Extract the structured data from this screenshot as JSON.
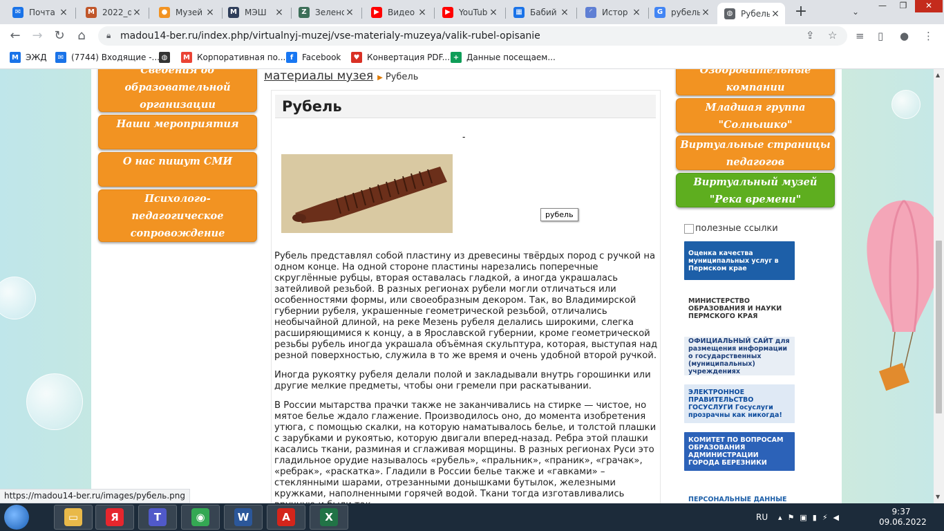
{
  "browser": {
    "tabs": [
      {
        "label": "Почта",
        "icon": "mail-icon",
        "color": "#1a73e8",
        "glyph": "✉"
      },
      {
        "label": "2022_q",
        "icon": "m-logo-icon",
        "color": "#c0562a",
        "glyph": "M"
      },
      {
        "label": "Музей",
        "icon": "site-icon",
        "color": "#f29322",
        "glyph": "●"
      },
      {
        "label": "МЭШ",
        "icon": "mesh-icon",
        "color": "#2f3e5a",
        "glyph": "M"
      },
      {
        "label": "Зелено",
        "icon": "spreadsheet-icon",
        "color": "#3c6e58",
        "glyph": "Z"
      },
      {
        "label": "Видео",
        "icon": "youtube-icon",
        "color": "#ff0000",
        "glyph": "▶"
      },
      {
        "label": "YouTub",
        "icon": "youtube-icon",
        "color": "#ff0000",
        "glyph": "▶"
      },
      {
        "label": "Бабий",
        "icon": "table-icon",
        "color": "#1a73e8",
        "glyph": "▦"
      },
      {
        "label": "Истор",
        "icon": "loading-icon",
        "color": "#5f7fd4",
        "glyph": "◜"
      },
      {
        "label": "рубель",
        "icon": "google-icon",
        "color": "#4285f4",
        "glyph": "G"
      },
      {
        "label": "Рубель",
        "icon": "globe-icon",
        "color": "#5f6368",
        "glyph": "◍",
        "active": true
      }
    ],
    "url": "madou14-ber.ru/index.php/virtualnyj-muzej/vse-materialy-muzeya/valik-rubel-opisanie",
    "bookmarks": [
      {
        "label": "ЭЖД",
        "icon": "m-icon",
        "color": "#1a73e8",
        "glyph": "M"
      },
      {
        "label": "(7744) Входящие -...",
        "icon": "mail-icon",
        "color": "#1a73e8",
        "glyph": "✉"
      },
      {
        "label": "",
        "icon": "globe-icon",
        "color": "#333333",
        "glyph": "◍"
      },
      {
        "label": "Корпоративная по...",
        "icon": "gmail-icon",
        "color": "#ea4335",
        "glyph": "M"
      },
      {
        "label": "Facebook",
        "icon": "facebook-icon",
        "color": "#1877f2",
        "glyph": "f"
      },
      {
        "label": "Конвертация PDF...",
        "icon": "heart-icon",
        "color": "#d93025",
        "glyph": "♥"
      },
      {
        "label": "Данные посещаем...",
        "icon": "sheet-icon",
        "color": "#0f9d58",
        "glyph": "+"
      }
    ],
    "status_url": "https://madou14-ber.ru/images/рубель.png"
  },
  "page": {
    "left_menu": [
      "Сведения об образовательной организации",
      "Наши мероприятия",
      "О нас пишут СМИ",
      "Психолого-педагогическое сопровождение"
    ],
    "right_menu": [
      "Оздоровительные компании",
      "Младшая группа \"Солнышко\"",
      "Виртуальные страницы педагогов",
      "Виртуальный музей \"Река времени\""
    ],
    "breadcrumb": {
      "parent": "материалы музея",
      "current": "Рубель"
    },
    "article": {
      "title": "Рубель",
      "dash": "-",
      "image_caption": "рубель",
      "paragraphs": [
        "Рубель представлял собой пластину из древесины твёрдых пород с ручкой на одном конце. На одной стороне пластины нарезались поперечные скруглённые рубцы, вторая оставалась гладкой, а иногда украшалась затейливой резьбой. В разных регионах рубели могли отличаться или особенностями формы, или своеобразным декором. Так, во Владимирской губернии рубеля, украшенные геометрической резьбой, отличались необычайной длиной, на реке Мезень рубеля делались широкими, слегка расширяющимися к концу, а в Ярославской губернии, кроме геометрической резьбы рубель иногда украшала объёмная скульптура, которая, выступая над резной поверхностью, служила в то же время и очень удобной второй ручкой.",
        "Иногда рукоятку рубеля делали полой и закладывали внутрь горошинки или другие мелкие предметы, чтобы они гремели при раскатывании.",
        "В России мытарства прачки также не заканчивались на стирке — чистое, но мятое белье ждало глажение. Производилось оно, до момента изобретения утюга, с помощью скалки, на которую наматывалось белье, и толстой плашки с зарубками и рукоятью, которую двигали вперед-назад. Ребра этой плашки касались ткани, разминая и сглаживая морщины. В разных регионах Руси это гладильное орудие называлось «рубель», «пральник», «праник», «грачак», «ребрак», «раскатка». Гладили в России белье также и «гавками» – стеклянными шарами, отрезанными донышками бутылок, железными кружками, наполненными горячей водой. Ткани тогда изготавливались вручную и были так"
      ]
    },
    "useful_links_alt": "полезные ссылки",
    "banners": [
      {
        "text": "Оценка качества муниципальных услуг в Пермском крае",
        "bg": "#1d5fa8",
        "fg": "#ffffff"
      },
      {
        "text": "МИНИСТЕРСТВО ОБРАЗОВАНИЯ И НАУКИ ПЕРМСКОГО КРАЯ",
        "bg": "#ffffff",
        "fg": "#333333"
      },
      {
        "text": "ОФИЦИАЛЬНЫЙ САЙТ для размещения информации о государственных (муниципальных) учреждениях",
        "bg": "#e8eef5",
        "fg": "#1d3f7a"
      },
      {
        "text": "ЭЛЕКТРОННОЕ ПРАВИТЕЛЬСТВО ГОСУСЛУГИ Госуслуги прозрачны как никогда!",
        "bg": "#dfe9f5",
        "fg": "#0b4a9c"
      },
      {
        "text": "КОМИТЕТ ПО ВОПРОСАМ ОБРАЗОВАНИЯ АДМИНИСТРАЦИИ ГОРОДА БЕРЕЗНИКИ",
        "bg": "#2c62b8",
        "fg": "#ffffff"
      },
      {
        "text": "ПЕРСОНАЛЬНЫЕ ДАННЫЕ",
        "bg": "#ffffff",
        "fg": "#1d5fa8"
      }
    ]
  },
  "taskbar": {
    "apps": [
      {
        "name": "file-explorer-icon",
        "glyph": "▭",
        "color": "#e9b949"
      },
      {
        "name": "yandex-icon",
        "glyph": "Я",
        "color": "#e6262d"
      },
      {
        "name": "teams-icon",
        "glyph": "T",
        "color": "#5059c9"
      },
      {
        "name": "chrome-icon",
        "glyph": "◉",
        "color": "#34a853"
      },
      {
        "name": "word-icon",
        "glyph": "W",
        "color": "#2b579a"
      },
      {
        "name": "acrobat-icon",
        "glyph": "A",
        "color": "#d4251b"
      },
      {
        "name": "excel-icon",
        "glyph": "X",
        "color": "#217346"
      }
    ],
    "lang": "RU",
    "time": "9:37",
    "date": "09.06.2022"
  }
}
